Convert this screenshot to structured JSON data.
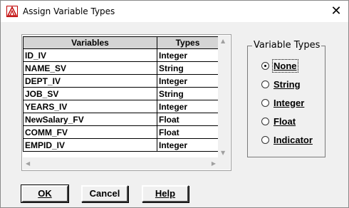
{
  "window": {
    "title": "Assign Variable Types",
    "close_glyph": "✕"
  },
  "table": {
    "headers": [
      "Variables",
      "Types"
    ],
    "rows": [
      {
        "variable": "ID_IV",
        "type": "Integer"
      },
      {
        "variable": "NAME_SV",
        "type": "String"
      },
      {
        "variable": "DEPT_IV",
        "type": "Integer"
      },
      {
        "variable": "JOB_SV",
        "type": "String"
      },
      {
        "variable": "YEARS_IV",
        "type": "Integer"
      },
      {
        "variable": "NewSalary_FV",
        "type": "Float"
      },
      {
        "variable": "COMM_FV",
        "type": "Float"
      },
      {
        "variable": "EMPID_IV",
        "type": "Integer"
      }
    ]
  },
  "variable_types": {
    "legend": "Variable Types",
    "options": [
      {
        "label": "None",
        "mnemonic_index": 0,
        "checked": true
      },
      {
        "label": "String",
        "mnemonic_index": 0,
        "checked": false
      },
      {
        "label": "Integer",
        "mnemonic_index": 0,
        "checked": false
      },
      {
        "label": "Float",
        "mnemonic_index": 0,
        "checked": false
      },
      {
        "label": "Indicator",
        "mnemonic_index": 1,
        "checked": false
      }
    ]
  },
  "buttons": {
    "ok": "OK",
    "cancel": "Cancel",
    "help": "Help"
  },
  "icons": {
    "app": "app-icon",
    "close": "close-icon",
    "scroll_up": "scroll-up-icon",
    "scroll_down": "scroll-down-icon",
    "scroll_left": "scroll-left-icon",
    "scroll_right": "scroll-right-icon"
  }
}
